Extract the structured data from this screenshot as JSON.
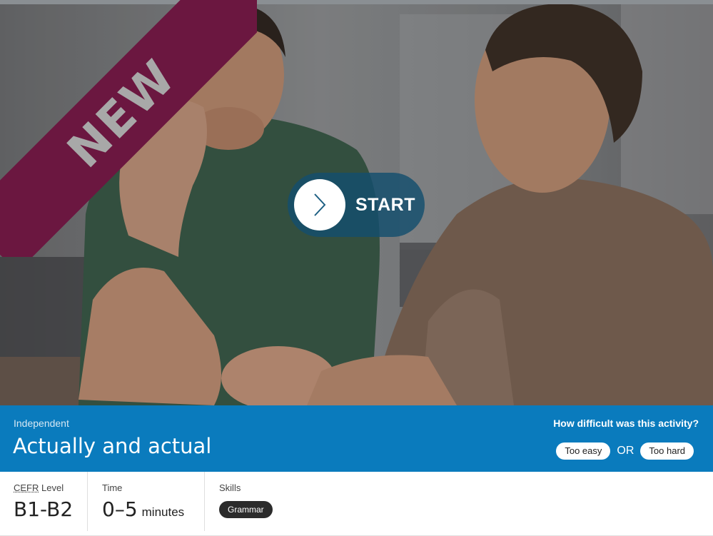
{
  "hero": {
    "badge_text": "NEW",
    "start_label": "START"
  },
  "activity": {
    "category": "Independent",
    "title": "Actually and actual"
  },
  "feedback": {
    "question": "How difficult was this activity?",
    "too_easy_label": "Too easy",
    "or_text": "OR",
    "too_hard_label": "Too hard"
  },
  "info": {
    "cefr": {
      "label_abbr": "CEFR",
      "label_rest": " Level",
      "value": "B1-B2"
    },
    "time": {
      "label": "Time",
      "value": "0–5",
      "unit": "minutes"
    },
    "skills": {
      "label": "Skills",
      "tags": [
        "Grammar"
      ]
    }
  },
  "colors": {
    "band": "#0a7bbd",
    "ribbon": "#6b1740",
    "start_button": "#144e6e",
    "skill_tag": "#2b2b2b"
  },
  "icons": {
    "start": "chevron-right-icon"
  }
}
